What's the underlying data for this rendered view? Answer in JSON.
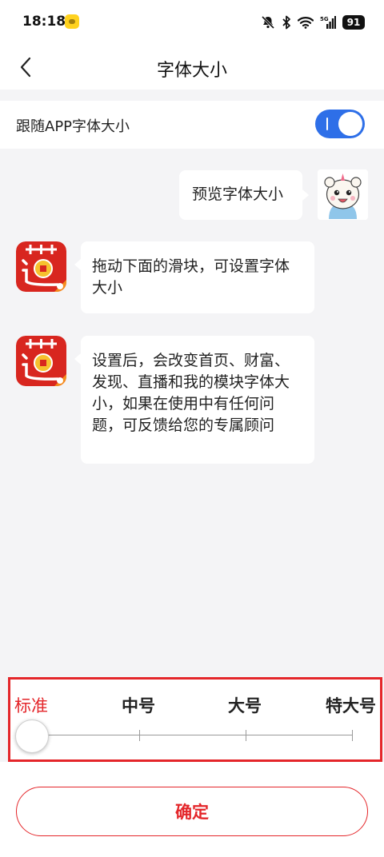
{
  "status_bar": {
    "time": "18:18",
    "battery": "91",
    "network": "5G",
    "icons": [
      "app-notification-icon",
      "bell-muted-icon",
      "bluetooth-icon",
      "wifi-icon",
      "signal-icon",
      "battery-icon"
    ]
  },
  "header": {
    "title": "字体大小",
    "back_icon": "chevron-left-icon"
  },
  "follow_app_font": {
    "label": "跟随APP字体大小",
    "enabled": true
  },
  "preview": {
    "user_message": "预览字体大小",
    "messages": [
      "拖动下面的滑块，可设置字体大小",
      "设置后，会改变首页、财富、发现、直播和我的模块字体大小，如果在使用中有任何问题，可反馈给您的专属顾问"
    ]
  },
  "size_options": [
    "标准",
    "中号",
    "大号",
    "特大号"
  ],
  "selected_size_index": 0,
  "confirm_label": "确定",
  "colors": {
    "accent_red": "#e4262a",
    "toggle_blue": "#2e6fe8",
    "background": "#f4f4f6"
  }
}
